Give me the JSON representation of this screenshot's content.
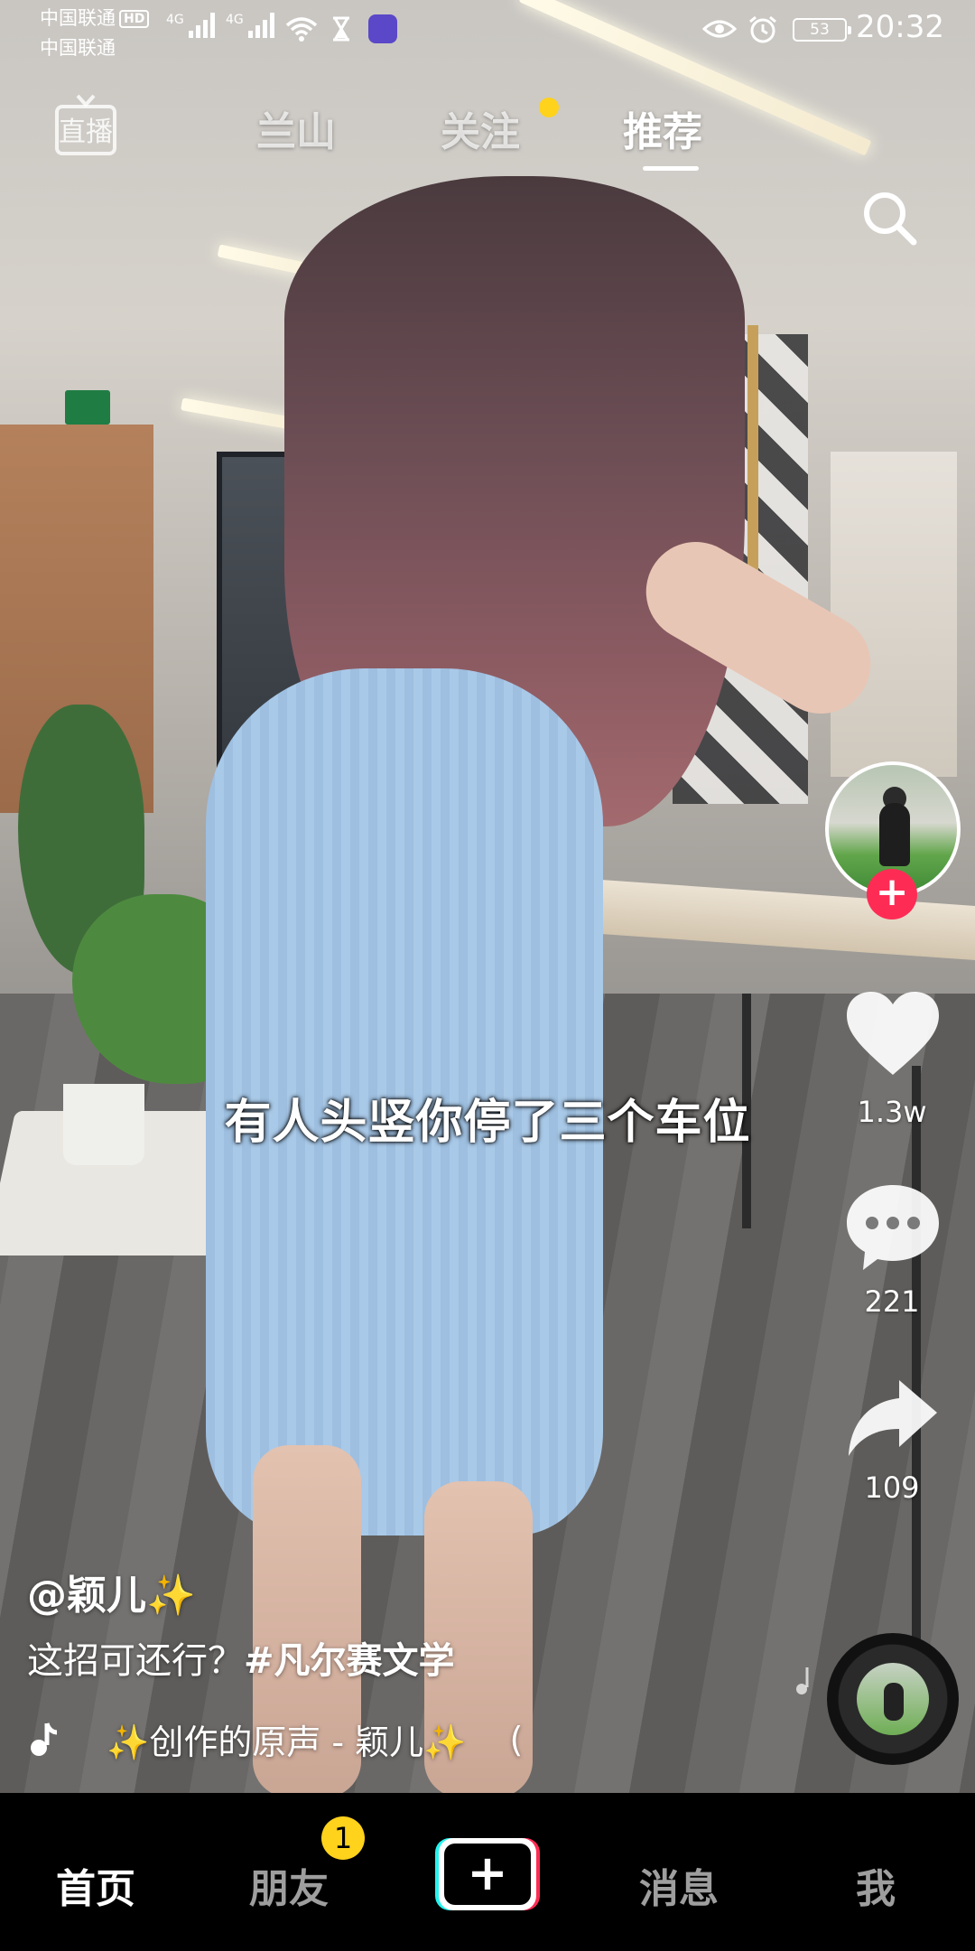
{
  "status_bar": {
    "carrier1": "中国联通",
    "hd": "HD",
    "carrier2": "中国联通",
    "net1": "4G",
    "net2": "4G",
    "battery": "53",
    "time": "20:32"
  },
  "top_nav": {
    "live": "直播",
    "tabs": [
      "兰山",
      "关注",
      "推荐"
    ],
    "active_tab": "推荐",
    "follow_dot_color": "#ffd21c"
  },
  "video": {
    "subtitle": "有人头竖你停了三个车位",
    "author": "@颖儿✨",
    "description": "这招可还行？",
    "hashtag": "#凡尔赛文学",
    "music": "✨创作的原声 - 颖儿✨",
    "music_trailing": "("
  },
  "actions": {
    "likes": "1.3w",
    "comments": "221",
    "shares": "109",
    "follow_button_color": "#fe2c55"
  },
  "bottom_nav": {
    "items": [
      "首页",
      "朋友",
      "消息",
      "我"
    ],
    "active": "首页",
    "friends_badge": "1",
    "create_icon": "plus-icon"
  }
}
